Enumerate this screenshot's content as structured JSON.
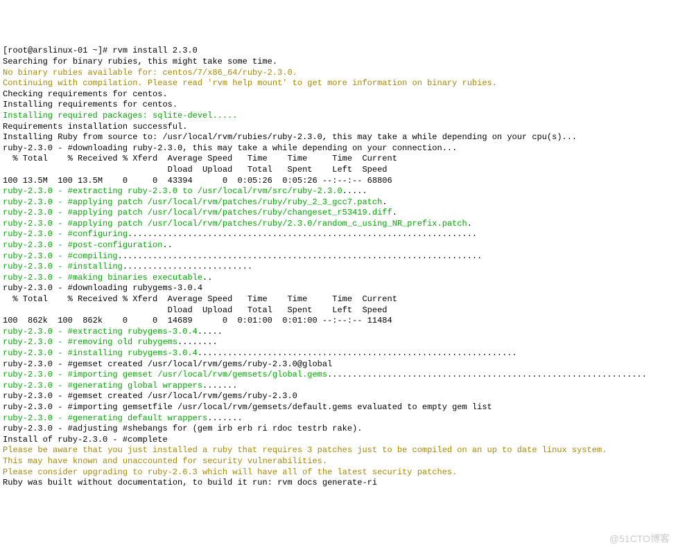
{
  "lines": [
    {
      "cls": "black",
      "text": "[root@arslinux-01 ~]# rvm install 2.3.0"
    },
    {
      "cls": "black",
      "text": "Searching for binary rubies, this might take some time."
    },
    {
      "cls": "yellow",
      "text": "No binary rubies available for: centos/7/x86_64/ruby-2.3.0."
    },
    {
      "cls": "yellow",
      "text": "Continuing with compilation. Please read 'rvm help mount' to get more information on binary rubies."
    },
    {
      "cls": "black",
      "text": "Checking requirements for centos."
    },
    {
      "cls": "black",
      "text": "Installing requirements for centos."
    },
    {
      "cls": "green",
      "text": "Installing required packages: sqlite-devel....."
    },
    {
      "cls": "black",
      "text": "Requirements installation successful."
    },
    {
      "cls": "black",
      "text": "Installing Ruby from source to: /usr/local/rvm/rubies/ruby-2.3.0, this may take a while depending on your cpu(s)..."
    },
    {
      "cls": "black",
      "text": "ruby-2.3.0 - #downloading ruby-2.3.0, this may take a while depending on your connection..."
    },
    {
      "cls": "black",
      "text": "  % Total    % Received % Xferd  Average Speed   Time    Time     Time  Current"
    },
    {
      "cls": "black",
      "text": "                                 Dload  Upload   Total   Spent    Left  Speed"
    },
    {
      "cls": "black",
      "text": "100 13.5M  100 13.5M    0     0  43394      0  0:05:26  0:05:26 --:--:-- 68806"
    },
    {
      "cls": "black",
      "text": "ruby-2.3.0 - #extracting ruby-2.3.0 to /usr/local/rvm/src/ruby-2.3.0....."
    },
    {
      "cls": "black",
      "text": "ruby-2.3.0 - #applying patch /usr/local/rvm/patches/ruby/ruby_2_3_gcc7.patch."
    },
    {
      "cls": "black",
      "text": "ruby-2.3.0 - #applying patch /usr/local/rvm/patches/ruby/changeset_r53419.diff."
    },
    {
      "cls": "black",
      "text": "ruby-2.3.0 - #applying patch /usr/local/rvm/patches/ruby/2.3.0/random_c_using_NR_prefix.patch."
    },
    {
      "cls": "black",
      "text": "ruby-2.3.0 - #configuring......................................................................"
    },
    {
      "cls": "black",
      "text": "ruby-2.3.0 - #post-configuration.."
    },
    {
      "cls": "black",
      "text": "ruby-2.3.0 - #compiling........................................................................."
    },
    {
      "cls": "black",
      "text": "ruby-2.3.0 - #installing.........................."
    },
    {
      "cls": "black",
      "text": "ruby-2.3.0 - #making binaries executable.."
    },
    {
      "cls": "black",
      "text": "ruby-2.3.0 - #downloading rubygems-3.0.4"
    },
    {
      "cls": "black",
      "text": "  % Total    % Received % Xferd  Average Speed   Time    Time     Time  Current"
    },
    {
      "cls": "black",
      "text": "                                 Dload  Upload   Total   Spent    Left  Speed"
    },
    {
      "cls": "black",
      "text": "100  862k  100  862k    0     0  14689      0  0:01:00  0:01:00 --:--:-- 11484"
    },
    {
      "cls": "black",
      "text": "ruby-2.3.0 - #extracting rubygems-3.0.4....."
    },
    {
      "cls": "black",
      "text": "ruby-2.3.0 - #removing old rubygems........"
    },
    {
      "cls": "black",
      "text": "ruby-2.3.0 - #installing rubygems-3.0.4................................................................"
    },
    {
      "cls": "black",
      "text": "ruby-2.3.0 - #gemset created /usr/local/rvm/gems/ruby-2.3.0@global"
    },
    {
      "cls": "black",
      "text": "ruby-2.3.0 - #importing gemset /usr/local/rvm/gemsets/global.gems................................................................"
    },
    {
      "cls": "black",
      "text": "ruby-2.3.0 - #generating global wrappers......."
    },
    {
      "cls": "black",
      "text": "ruby-2.3.0 - #gemset created /usr/local/rvm/gems/ruby-2.3.0"
    },
    {
      "cls": "black",
      "text": "ruby-2.3.0 - #importing gemsetfile /usr/local/rvm/gemsets/default.gems evaluated to empty gem list"
    },
    {
      "cls": "black",
      "text": "ruby-2.3.0 - #generating default wrappers......."
    },
    {
      "cls": "black",
      "text": "ruby-2.3.0 - #adjusting #shebangs for (gem irb erb ri rdoc testrb rake)."
    },
    {
      "cls": "black",
      "text": "Install of ruby-2.3.0 - #complete "
    },
    {
      "cls": "yellow",
      "text": "Please be aware that you just installed a ruby that requires 3 patches just to be compiled on an up to date linux system."
    },
    {
      "cls": "yellow",
      "text": "This may have known and unaccounted for security vulnerabilities."
    },
    {
      "cls": "yellow",
      "text": "Please consider upgrading to ruby-2.6.3 which will have all of the latest security patches."
    },
    {
      "cls": "black",
      "text": "Ruby was built without documentation, to build it run: rvm docs generate-ri"
    }
  ],
  "greenPrefixes": {
    "13": {
      "prefix": "ruby-2.3.0 - #extracting ruby-2.3.0 to /usr/local/rvm/src/ruby-2.3.0",
      "rest": "....."
    },
    "14": {
      "prefix": "ruby-2.3.0 - #applying patch /usr/local/rvm/patches/ruby/ruby_2_3_gcc7.patch",
      "rest": "."
    },
    "15": {
      "prefix": "ruby-2.3.0 - #applying patch /usr/local/rvm/patches/ruby/changeset_r53419.diff",
      "rest": "."
    },
    "16": {
      "prefix": "ruby-2.3.0 - #applying patch /usr/local/rvm/patches/ruby/2.3.0/random_c_using_NR_prefix.patch",
      "rest": "."
    },
    "17": {
      "prefix": "ruby-2.3.0 - #configuring",
      "rest": "......................................................................"
    },
    "18": {
      "prefix": "ruby-2.3.0 - #post-configuration",
      "rest": ".."
    },
    "19": {
      "prefix": "ruby-2.3.0 - #compiling",
      "rest": "........................................................................."
    },
    "20": {
      "prefix": "ruby-2.3.0 - #installing",
      "rest": ".........................."
    },
    "21": {
      "prefix": "ruby-2.3.0 - #making binaries executable",
      "rest": ".."
    },
    "26": {
      "prefix": "ruby-2.3.0 - #extracting rubygems-3.0.4",
      "rest": "....."
    },
    "27": {
      "prefix": "ruby-2.3.0 - #removing old rubygems",
      "rest": "........"
    },
    "28": {
      "prefix": "ruby-2.3.0 - #installing rubygems-3.0.4",
      "rest": "................................................................"
    },
    "30": {
      "prefix": "ruby-2.3.0 - #importing gemset /usr/local/rvm/gemsets/global.gems",
      "rest": "................................................................"
    },
    "31": {
      "prefix": "ruby-2.3.0 - #generating global wrappers",
      "rest": "......."
    },
    "34": {
      "prefix": "ruby-2.3.0 - #generating default wrappers",
      "rest": "......."
    }
  },
  "watermark": "@51CTO博客"
}
